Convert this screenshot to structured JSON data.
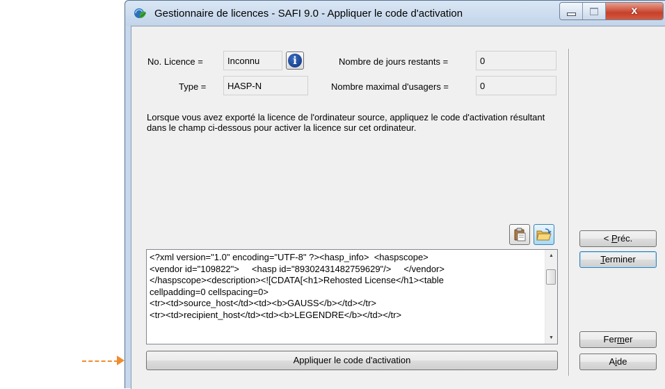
{
  "window": {
    "title": "Gestionnaire de licences - SAFI 9.0 - Appliquer le code d'activation",
    "controls": {
      "minimize": "_",
      "maximize": "□",
      "close": "x"
    }
  },
  "license": {
    "no_label": "No. Licence =",
    "no_value": "Inconnu",
    "type_label": "Type =",
    "type_value": "HASP-N",
    "days_label": "Nombre de jours restants =",
    "days_value": "0",
    "users_label": "Nombre maximal d'usagers =",
    "users_value": "0"
  },
  "description": "Lorsque vous avez exporté la licence de l'ordinateur source, appliquez le code d'activation résultant dans le champ ci-dessous pour activer la licence sur cet ordinateur.",
  "activation_code": "<?xml version=\"1.0\" encoding=\"UTF-8\" ?><hasp_info>  <haspscope>\n<vendor id=\"109822\">     <hasp id=\"89302431482759629\"/>     </vendor>\n</haspscope><description><![CDATA[<h1>Rehosted License</h1><table\ncellpadding=0 cellspacing=0>\n<tr><td>source_host</td><td><b>GAUSS</b></td></tr>\n<tr><td>recipient_host</td><td><b>LEGENDRE</b></td></tr>",
  "buttons": {
    "apply": "Appliquer le code d'activation",
    "prev_pre": "< ",
    "prev_u": "P",
    "prev_post": "réc.",
    "finish_u": "T",
    "finish_post": "erminer",
    "close_pre": "Fer",
    "close_u": "m",
    "close_post": "er",
    "help_pre": "A",
    "help_u": "i",
    "help_post": "de"
  },
  "colors": {
    "arrow": "#f08c2e",
    "window_frame": "#c7d8ec",
    "dialog_bg": "#f0f0f0"
  },
  "icons": [
    "app-icon",
    "info-icon",
    "paste-icon",
    "open-folder-icon"
  ]
}
